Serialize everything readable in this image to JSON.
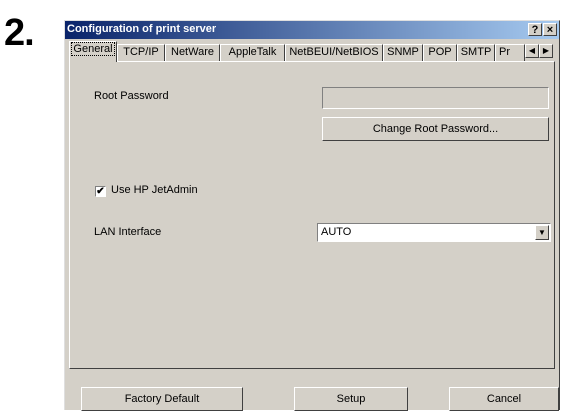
{
  "step_number": "2.",
  "window": {
    "title": "Configuration of print server",
    "help_button": "?",
    "close_button": "×"
  },
  "tabs": [
    "General",
    "TCP/IP",
    "NetWare",
    "AppleTalk",
    "NetBEUI/NetBIOS",
    "SNMP",
    "POP",
    "SMTP",
    "Pr"
  ],
  "active_tab": "General",
  "tab_scroll": {
    "left": "◀",
    "right": "▶"
  },
  "general": {
    "root_password_label": "Root Password",
    "root_password_value": "",
    "change_password_button": "Change Root Password...",
    "use_jetadmin_label": "Use HP JetAdmin",
    "use_jetadmin_checked": true,
    "checkbox_mark": "✔",
    "lan_interface_label": "LAN Interface",
    "lan_interface_value": "AUTO",
    "dropdown_arrow": "▼"
  },
  "footer": {
    "factory_default_button": "Factory Default",
    "setup_button": "Setup",
    "cancel_button": "Cancel"
  }
}
